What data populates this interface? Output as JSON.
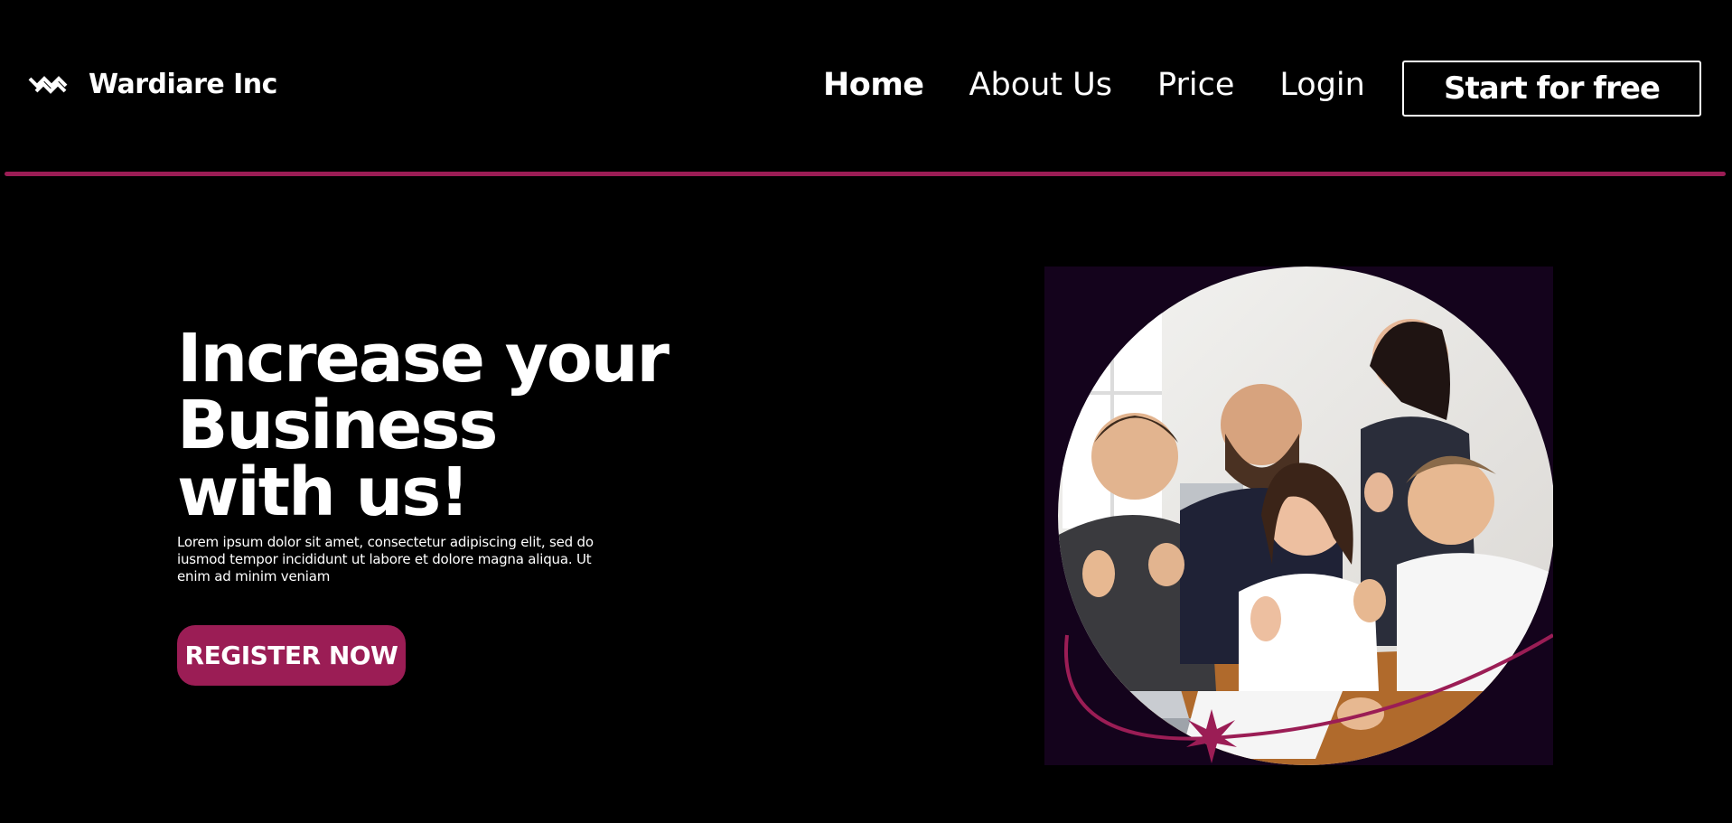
{
  "header": {
    "brand_name": "Wardiare Inc",
    "logo_icon": "wave-chevron-logo-icon",
    "nav": [
      {
        "label": "Home",
        "active": true
      },
      {
        "label": "About Us",
        "active": false
      },
      {
        "label": "Price",
        "active": false
      },
      {
        "label": "Login",
        "active": false
      }
    ],
    "cta_label": "Start for free"
  },
  "hero": {
    "title_lines": [
      "Increase your",
      "Business",
      "with us!"
    ],
    "description": "Lorem ipsum dolor sit amet, consectetur adipiscing elit, sed do iusmod tempor incididunt ut labore et dolore magna aliqua. Ut enim ad minim veniam",
    "register_label": "REGISTER NOW",
    "image_subject": "team-photo"
  },
  "colors": {
    "background": "#000000",
    "accent": "#9b1d55",
    "text": "#ffffff",
    "image_backdrop": "#14031c"
  }
}
